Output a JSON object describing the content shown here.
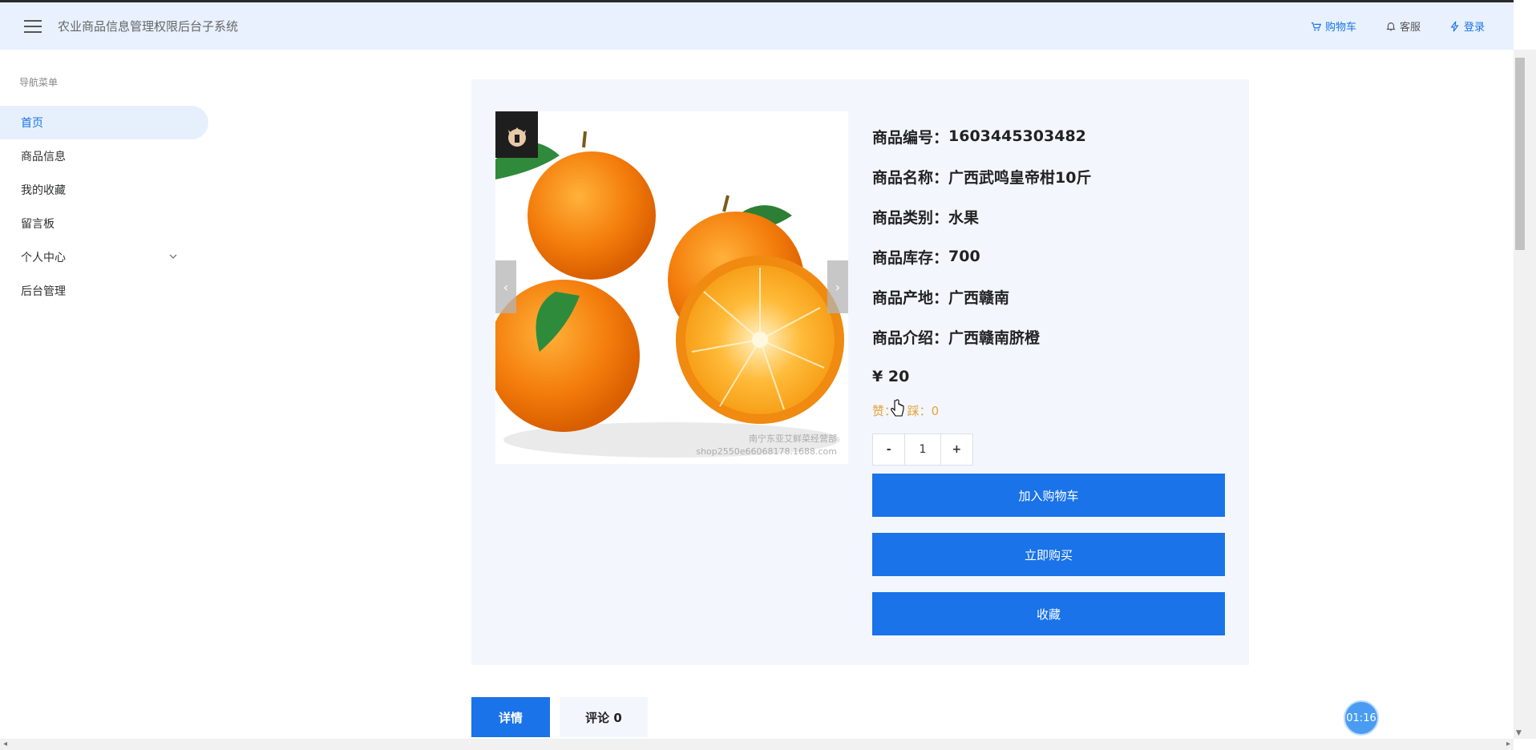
{
  "header": {
    "title": "农业商品信息管理权限后台子系统",
    "links": {
      "cart": "购物车",
      "service": "客服",
      "login": "登录"
    }
  },
  "sidebar": {
    "heading": "导航菜单",
    "items": [
      {
        "label": "首页"
      },
      {
        "label": "商品信息"
      },
      {
        "label": "我的收藏"
      },
      {
        "label": "留言板"
      },
      {
        "label": "个人中心"
      },
      {
        "label": "后台管理"
      }
    ]
  },
  "product": {
    "fields": [
      {
        "label": "商品编号：",
        "value": "1603445303482"
      },
      {
        "label": "商品名称：",
        "value": "广西武鸣皇帝柑10斤"
      },
      {
        "label": "商品类别：",
        "value": "水果"
      },
      {
        "label": "商品库存：",
        "value": "700"
      },
      {
        "label": "商品产地：",
        "value": "广西赣南"
      },
      {
        "label": "商品介绍：",
        "value": "广西赣南脐橙"
      }
    ],
    "price_symbol": "¥",
    "price": "20",
    "votes": {
      "like_label": "赞：",
      "like_count": "0",
      "dislike_label": "踩：",
      "dislike_count": "0"
    },
    "quantity": {
      "minus": "-",
      "value": "1",
      "plus": "+"
    },
    "buttons": {
      "add_to_cart": "加入购物车",
      "buy_now": "立即购买",
      "favorite": "收藏"
    },
    "image": {
      "watermark_line1": "南宁东亚艾鲜菜经营部",
      "watermark_line2": "shop2550e66068178.1688.com"
    }
  },
  "tabs": [
    {
      "label": "详情"
    },
    {
      "label": "评论 0"
    }
  ],
  "timer": "01:16",
  "colors": {
    "primary": "#1a73e8",
    "header_bg": "#e8f1fd",
    "card_bg": "#f3f7fd",
    "vote": "#e6a23c"
  }
}
